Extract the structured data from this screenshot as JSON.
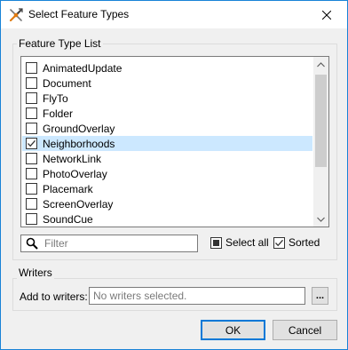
{
  "window": {
    "title": "Select Feature Types"
  },
  "feature_group": {
    "label": "Feature Type List"
  },
  "feature_types": [
    {
      "label": "AnimatedUpdate",
      "checked": false,
      "selected": false
    },
    {
      "label": "Document",
      "checked": false,
      "selected": false
    },
    {
      "label": "FlyTo",
      "checked": false,
      "selected": false
    },
    {
      "label": "Folder",
      "checked": false,
      "selected": false
    },
    {
      "label": "GroundOverlay",
      "checked": false,
      "selected": false
    },
    {
      "label": "Neighborhoods",
      "checked": true,
      "selected": true
    },
    {
      "label": "NetworkLink",
      "checked": false,
      "selected": false
    },
    {
      "label": "PhotoOverlay",
      "checked": false,
      "selected": false
    },
    {
      "label": "Placemark",
      "checked": false,
      "selected": false
    },
    {
      "label": "ScreenOverlay",
      "checked": false,
      "selected": false
    },
    {
      "label": "SoundCue",
      "checked": false,
      "selected": false
    }
  ],
  "filter": {
    "placeholder": "Filter",
    "value": ""
  },
  "options": {
    "select_all": {
      "label": "Select all",
      "state": "indeterminate"
    },
    "sorted": {
      "label": "Sorted",
      "checked": true
    }
  },
  "writers_group": {
    "label": "Writers",
    "add_to_writers_label": "Add to writers:",
    "field_placeholder": "No writers selected.",
    "browse_label": "..."
  },
  "buttons": {
    "ok": "OK",
    "cancel": "Cancel"
  },
  "colors": {
    "accent": "#0078d7",
    "selection": "#cce8ff",
    "window_border": "#1883d7"
  }
}
